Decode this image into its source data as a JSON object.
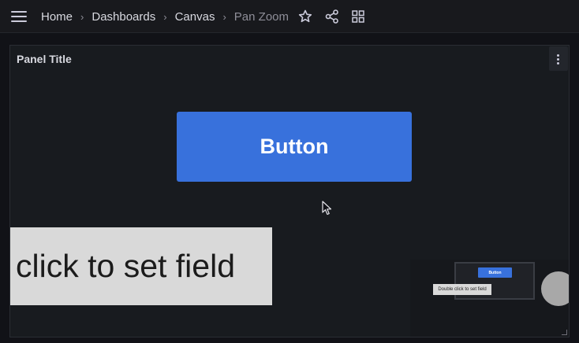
{
  "breadcrumbs": [
    "Home",
    "Dashboards",
    "Canvas",
    "Pan Zoom"
  ],
  "breadcrumb_separator": "›",
  "toolbar_icons": [
    "star-icon",
    "share-icon",
    "grid-icon"
  ],
  "panel": {
    "title": "Panel Title",
    "button_label": "Button",
    "text_field": "click to set field",
    "minimap": {
      "button_label": "Button",
      "text_field": "Double click to set field"
    }
  },
  "colors": {
    "accent": "#3871dc",
    "background": "#111217",
    "panel": "#181b1f",
    "text_field_bg": "#d9d9d9"
  }
}
